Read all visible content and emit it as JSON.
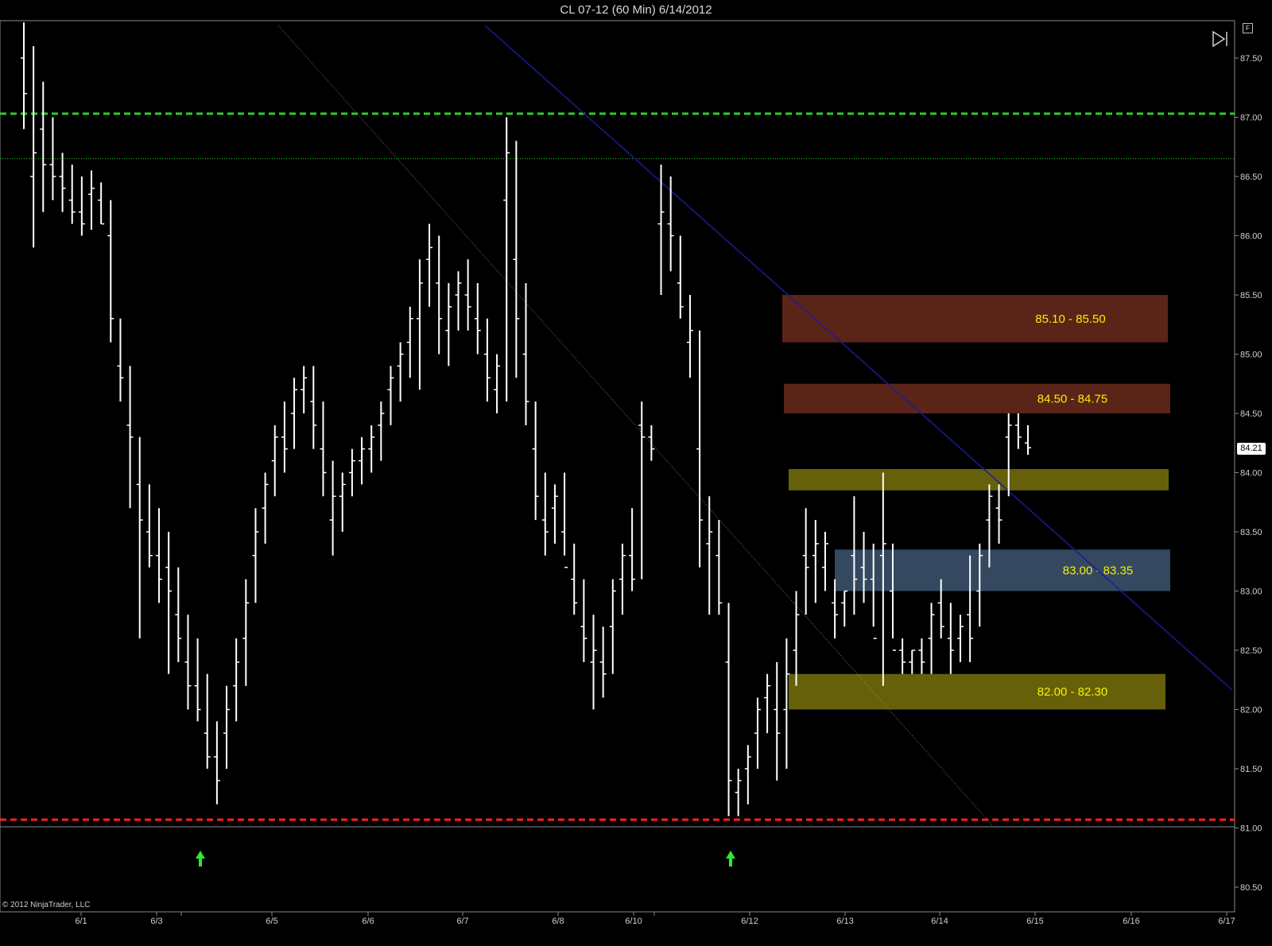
{
  "title": "CL 07-12 (60 Min)  6/14/2012",
  "copyright": "© 2012 NinjaTrader, LLC",
  "f_button": "F",
  "last_price_label": "84.21",
  "chart_data": {
    "type": "bar",
    "instrument": "CL 07-12",
    "timeframe": "60 Min",
    "ylim": [
      80.2,
      87.8
    ],
    "y_ticks": [
      "87.50",
      "87.00",
      "86.50",
      "86.00",
      "85.50",
      "85.00",
      "84.50",
      "84.00",
      "83.50",
      "83.00",
      "82.50",
      "82.00",
      "81.50",
      "81.00",
      "80.50"
    ],
    "x_ticks": [
      "6/1",
      "6/3",
      "6/5",
      "6/6",
      "6/7",
      "6/8",
      "6/10",
      "6/12",
      "6/13",
      "6/14",
      "6/15",
      "6/16",
      "6/17"
    ],
    "last_price": 84.21,
    "zones": [
      {
        "label": "85.10 - 85.50",
        "low": 85.1,
        "high": 85.5,
        "color": "#5a2418"
      },
      {
        "label": "84.50 - 84.75",
        "low": 84.5,
        "high": 84.75,
        "color": "#5a2418"
      },
      {
        "label": "",
        "low": 83.85,
        "high": 84.03,
        "color": "#66600a"
      },
      {
        "label": "83.00 - 83.35",
        "low": 83.0,
        "high": 83.35,
        "color": "#34495f"
      },
      {
        "label": "82.00 - 82.30",
        "low": 82.0,
        "high": 82.3,
        "color": "#66600a"
      }
    ],
    "horizontal_lines": [
      {
        "price": 87.03,
        "style": "dashed",
        "color": "#2ecc2e"
      },
      {
        "price": 86.65,
        "style": "dotted",
        "color": "#2ecc2e"
      },
      {
        "price": 81.07,
        "style": "dashed",
        "color": "#ff2020"
      }
    ],
    "signal_arrows": [
      "6/3",
      "6/11"
    ],
    "bars": [
      [
        87.8,
        86.9,
        87.5,
        87.2
      ],
      [
        87.6,
        85.9,
        86.5,
        86.7
      ],
      [
        87.3,
        86.2,
        86.9,
        86.6
      ],
      [
        87.0,
        86.3,
        86.6,
        86.5
      ],
      [
        86.7,
        86.2,
        86.5,
        86.4
      ],
      [
        86.6,
        86.1,
        86.3,
        86.2
      ],
      [
        86.5,
        86.0,
        86.2,
        86.1
      ],
      [
        86.55,
        86.05,
        86.35,
        86.4
      ],
      [
        86.45,
        86.1,
        86.3,
        86.1
      ],
      [
        86.3,
        85.1,
        86.0,
        85.3
      ],
      [
        85.3,
        84.6,
        84.9,
        84.8
      ],
      [
        84.9,
        83.7,
        84.4,
        84.3
      ],
      [
        84.3,
        82.6,
        83.9,
        83.6
      ],
      [
        83.9,
        83.2,
        83.5,
        83.3
      ],
      [
        83.7,
        82.9,
        83.3,
        83.1
      ],
      [
        83.5,
        82.3,
        83.2,
        83.0
      ],
      [
        83.2,
        82.4,
        82.8,
        82.6
      ],
      [
        82.8,
        82.0,
        82.4,
        82.2
      ],
      [
        82.6,
        81.9,
        82.2,
        82.0
      ],
      [
        82.3,
        81.5,
        81.8,
        81.6
      ],
      [
        81.9,
        81.2,
        81.6,
        81.4
      ],
      [
        82.2,
        81.5,
        81.8,
        82.0
      ],
      [
        82.6,
        81.9,
        82.2,
        82.4
      ],
      [
        83.1,
        82.2,
        82.6,
        82.9
      ],
      [
        83.7,
        82.9,
        83.3,
        83.5
      ],
      [
        84.0,
        83.4,
        83.7,
        83.9
      ],
      [
        84.4,
        83.8,
        84.1,
        84.3
      ],
      [
        84.6,
        84.0,
        84.3,
        84.2
      ],
      [
        84.8,
        84.2,
        84.5,
        84.7
      ],
      [
        84.9,
        84.5,
        84.7,
        84.8
      ],
      [
        84.9,
        84.2,
        84.6,
        84.4
      ],
      [
        84.6,
        83.8,
        84.2,
        84.0
      ],
      [
        84.1,
        83.3,
        83.6,
        83.8
      ],
      [
        84.0,
        83.5,
        83.8,
        83.9
      ],
      [
        84.2,
        83.8,
        84.0,
        84.1
      ],
      [
        84.3,
        83.9,
        84.1,
        84.2
      ],
      [
        84.4,
        84.0,
        84.2,
        84.3
      ],
      [
        84.6,
        84.1,
        84.4,
        84.5
      ],
      [
        84.9,
        84.4,
        84.7,
        84.8
      ],
      [
        85.1,
        84.6,
        84.9,
        85.0
      ],
      [
        85.4,
        84.8,
        85.1,
        85.3
      ],
      [
        85.8,
        84.7,
        85.3,
        85.6
      ],
      [
        86.1,
        85.4,
        85.8,
        85.9
      ],
      [
        86.0,
        85.0,
        85.6,
        85.3
      ],
      [
        85.6,
        84.9,
        85.2,
        85.4
      ],
      [
        85.7,
        85.2,
        85.5,
        85.6
      ],
      [
        85.8,
        85.2,
        85.5,
        85.4
      ],
      [
        85.6,
        85.0,
        85.3,
        85.2
      ],
      [
        85.3,
        84.6,
        85.0,
        84.8
      ],
      [
        85.0,
        84.5,
        84.7,
        84.9
      ],
      [
        87.0,
        84.6,
        86.3,
        86.7
      ],
      [
        86.8,
        84.8,
        85.8,
        85.3
      ],
      [
        85.6,
        84.4,
        85.0,
        84.6
      ],
      [
        84.6,
        83.6,
        84.2,
        83.8
      ],
      [
        84.0,
        83.3,
        83.6,
        83.5
      ],
      [
        83.9,
        83.4,
        83.7,
        83.8
      ],
      [
        84.0,
        83.3,
        83.5,
        83.2
      ],
      [
        83.4,
        82.8,
        83.1,
        82.9
      ],
      [
        83.1,
        82.4,
        82.7,
        82.6
      ],
      [
        82.8,
        82.0,
        82.4,
        82.5
      ],
      [
        82.7,
        82.1,
        82.4,
        82.3
      ],
      [
        83.1,
        82.3,
        82.7,
        83.0
      ],
      [
        83.4,
        82.8,
        83.1,
        83.3
      ],
      [
        83.7,
        83.0,
        83.3,
        83.1
      ],
      [
        84.6,
        83.1,
        84.4,
        84.3
      ],
      [
        84.4,
        84.1,
        84.3,
        84.2
      ],
      [
        86.6,
        85.5,
        86.1,
        86.2
      ],
      [
        86.5,
        85.7,
        86.1,
        86.0
      ],
      [
        86.0,
        85.3,
        85.6,
        85.4
      ],
      [
        85.5,
        84.8,
        85.1,
        85.2
      ],
      [
        85.2,
        83.2,
        84.2,
        83.6
      ],
      [
        83.8,
        82.8,
        83.4,
        83.5
      ],
      [
        83.6,
        82.8,
        83.3,
        82.9
      ],
      [
        82.9,
        81.1,
        82.4,
        81.4
      ],
      [
        81.5,
        81.1,
        81.3,
        81.4
      ],
      [
        81.7,
        81.2,
        81.5,
        81.6
      ],
      [
        82.1,
        81.5,
        81.8,
        82.0
      ],
      [
        82.3,
        81.8,
        82.1,
        82.2
      ],
      [
        82.4,
        81.4,
        82.0,
        81.8
      ],
      [
        82.6,
        81.5,
        82.0,
        82.3
      ],
      [
        83.0,
        82.2,
        82.5,
        82.8
      ],
      [
        83.7,
        82.8,
        83.3,
        83.2
      ],
      [
        83.6,
        82.9,
        83.3,
        83.4
      ],
      [
        83.5,
        83.0,
        83.2,
        83.4
      ],
      [
        83.1,
        82.6,
        82.9,
        82.8
      ],
      [
        83.0,
        82.7,
        82.9,
        83.0
      ],
      [
        83.8,
        82.8,
        83.3,
        83.1
      ],
      [
        83.5,
        82.9,
        83.2,
        83.1
      ],
      [
        83.4,
        82.7,
        83.1,
        82.6
      ],
      [
        84.0,
        82.2,
        83.3,
        83.4
      ],
      [
        83.4,
        82.6,
        83.0,
        82.5
      ],
      [
        82.6,
        82.3,
        82.5,
        82.4
      ],
      [
        82.5,
        82.3,
        82.4,
        82.5
      ],
      [
        82.6,
        82.3,
        82.5,
        82.4
      ],
      [
        82.9,
        82.3,
        82.6,
        82.8
      ],
      [
        83.1,
        82.6,
        82.9,
        82.7
      ],
      [
        82.9,
        82.3,
        82.6,
        82.5
      ],
      [
        82.8,
        82.4,
        82.6,
        82.7
      ],
      [
        83.3,
        82.4,
        82.8,
        82.6
      ],
      [
        83.4,
        82.7,
        83.0,
        83.3
      ],
      [
        83.9,
        83.2,
        83.6,
        83.8
      ],
      [
        83.9,
        83.4,
        83.7,
        83.6
      ],
      [
        84.5,
        83.8,
        84.3,
        84.4
      ],
      [
        84.5,
        84.2,
        84.4,
        84.3
      ],
      [
        84.4,
        84.15,
        84.25,
        84.21
      ]
    ]
  }
}
